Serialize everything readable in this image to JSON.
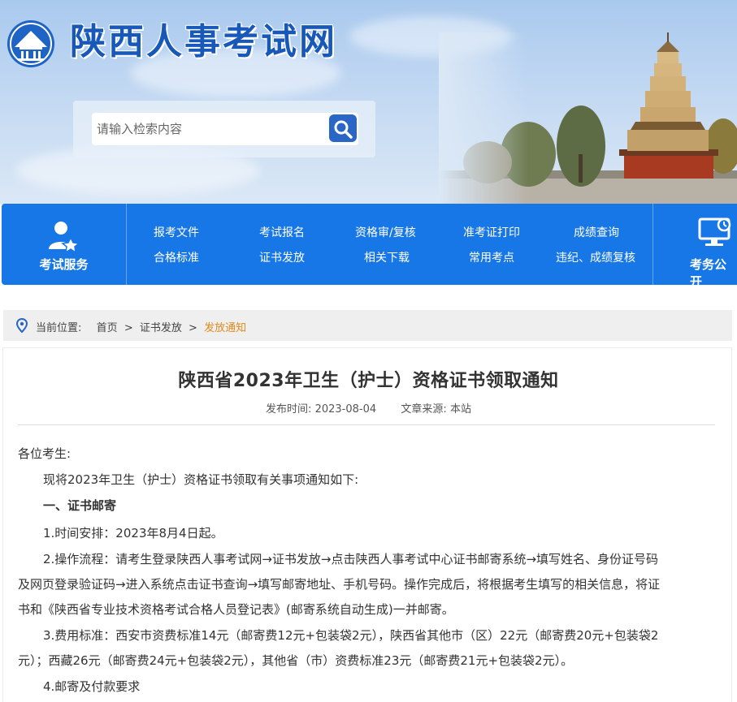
{
  "header": {
    "site_title": "陕西人事考试网",
    "search_placeholder": "请输入检索内容"
  },
  "nav": {
    "service_label": "考试服务",
    "public_label": "考务公开",
    "links": [
      {
        "label": "报考文件"
      },
      {
        "label": "合格标准"
      },
      {
        "label": "考试报名"
      },
      {
        "label": "证书发放"
      },
      {
        "label": "资格审/复核"
      },
      {
        "label": "相关下载"
      },
      {
        "label": "准考证打印"
      },
      {
        "label": "常用考点"
      },
      {
        "label": "成绩查询"
      },
      {
        "label": "违纪、成绩复核"
      }
    ]
  },
  "breadcrumb": {
    "prefix": "当前位置:",
    "items": [
      "首页",
      "证书发放",
      "发放通知"
    ],
    "separator": ">"
  },
  "article": {
    "title": "陕西省2023年卫生（护士）资格证书领取通知",
    "publish_label": "发布时间:",
    "publish_date": "2023-08-04",
    "source_label": "文章来源:",
    "source": "本站",
    "greeting": "各位考生:",
    "intro": "现将2023年卫生（护士）资格证书领取有关事项通知如下:",
    "section1": "一、证书邮寄",
    "item1": "1.时间安排：2023年8月4日起。",
    "item2_line1": "2.操作流程：请考生登录陕西人事考试网→证书发放→点击陕西人事考试中心证书邮寄系统→填写姓名、身份证号码",
    "item2_line2": "及网页登录验证码→进入系统点击证书查询→填写邮寄地址、手机号码。操作完成后，将根据考生填写的相关信息，将证",
    "item2_line3": "书和《陕西省专业技术资格考试合格人员登记表》(邮寄系统自动生成)一并邮寄。",
    "item3_line1": "3.费用标准：西安市资费标准14元（邮寄费12元+包装袋2元），陕西省其他市（区）22元（邮寄费20元+包装袋2",
    "item3_line2": "元）；西藏26元（邮寄费24元+包装袋2元），其他省（市）资费标准23元（邮寄费21元+包装袋2元）。",
    "item4": "4.邮寄及付款要求"
  },
  "colors": {
    "nav_blue": "#1877e6",
    "title_blue": "#1758b8",
    "breadcrumb_current": "#e08a1e"
  }
}
